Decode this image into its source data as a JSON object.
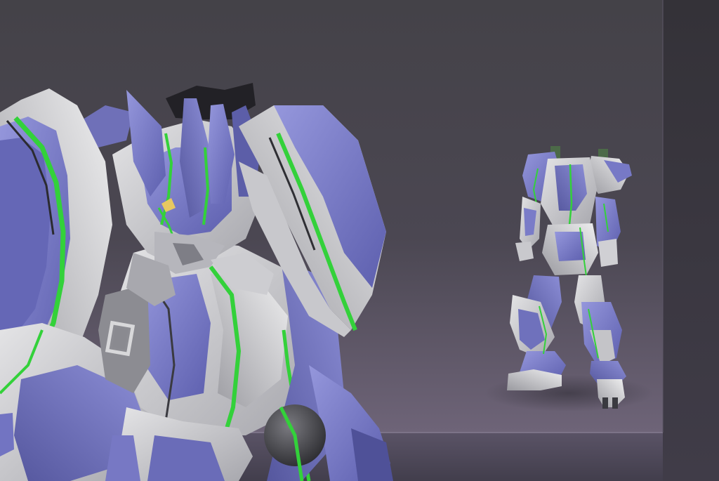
{
  "scene": {
    "subject": "mecha-robot-render",
    "views": [
      "close-up-head-torso",
      "full-body-standing"
    ]
  },
  "colors": {
    "background_top": "#444248",
    "background_bottom": "#6e6478",
    "backdrop_right": "#353339",
    "floor": "#4f4a58",
    "armor_white": "#d6d6d8",
    "armor_white_shade": "#9c9ca2",
    "armor_purple": "#7476c6",
    "armor_purple_light": "#9a9ce0",
    "armor_purple_dark": "#4d4f96",
    "accent_green": "#33d13a",
    "joint_dark": "#3a3a40"
  }
}
